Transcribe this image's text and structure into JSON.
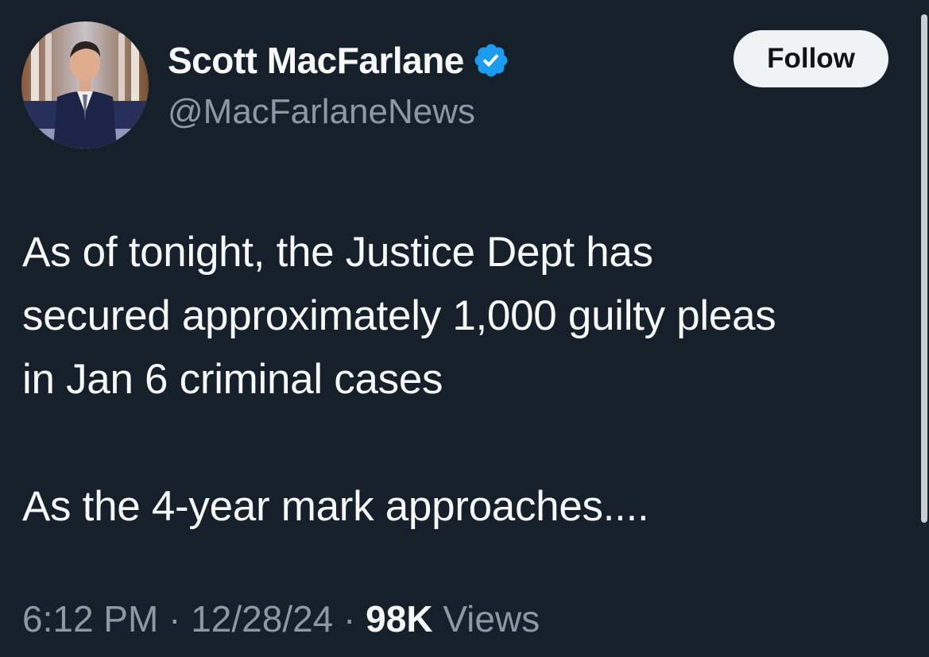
{
  "author": {
    "display_name": "Scott MacFarlane",
    "handle": "@MacFarlaneNews",
    "avatar_icon": "profile-photo",
    "verified_icon": "verified-badge-icon",
    "verified_color": "#1d9bf0"
  },
  "follow_button": {
    "label": "Follow"
  },
  "tweet": {
    "line1": "As of tonight, the Justice Dept has",
    "line2": "secured approximately 1,000 guilty pleas",
    "line3": "in Jan 6 criminal cases",
    "line4": "As the 4-year mark approaches...."
  },
  "meta": {
    "time": "6:12 PM",
    "separator": " · ",
    "date": "12/28/24",
    "views_count": "98K",
    "views_label": " Views"
  },
  "colors": {
    "background": "#15202b",
    "text_primary": "#f7f9f9",
    "text_secondary": "#8b98a5",
    "button_bg": "#eff3f4"
  }
}
